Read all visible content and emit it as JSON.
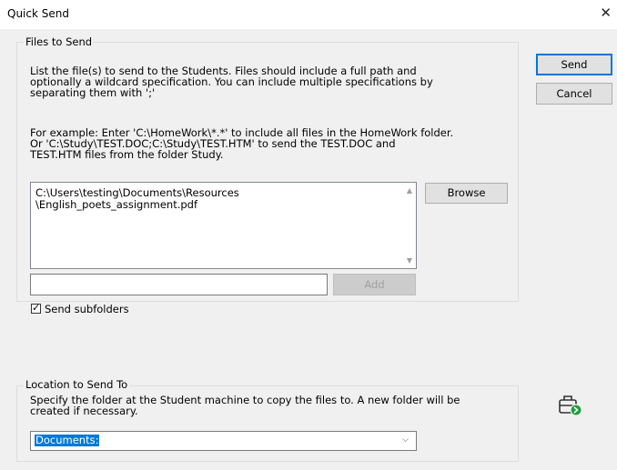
{
  "window": {
    "title": "Quick Send",
    "close_glyph": "✕"
  },
  "files_group": {
    "title": "Files to Send",
    "description": "List the file(s) to send to the Students. Files should include a full path and\noptionally a wildcard specification. You can include multiple specifications by\nseparating them with ';'",
    "example": "For example: Enter 'C:\\HomeWork\\*.*' to include all files in the HomeWork folder.\nOr 'C:\\Study\\TEST.DOC;C:\\Study\\TEST.HTM' to send the TEST.DOC and\nTEST.HTM files from the folder Study.",
    "file_list": "C:\\Users\\testing\\Documents\\Resources\n\\English_poets_assignment.pdf",
    "browse_label": "Browse",
    "add_value": "",
    "add_label": "Add"
  },
  "send_subfolders": {
    "label": "Send subfolders",
    "checked": true
  },
  "location_group": {
    "title": "Location to Send To",
    "description": "Specify the folder at the Student machine to copy the files to. A new folder will be\ncreated if necessary.",
    "selected": "Documents:"
  },
  "actions": {
    "send_label": "Send",
    "cancel_label": "Cancel"
  },
  "icons": {
    "send_badge": "briefcase-send-icon",
    "accent": "#0078d7",
    "badge_green": "#1e9e3a"
  }
}
